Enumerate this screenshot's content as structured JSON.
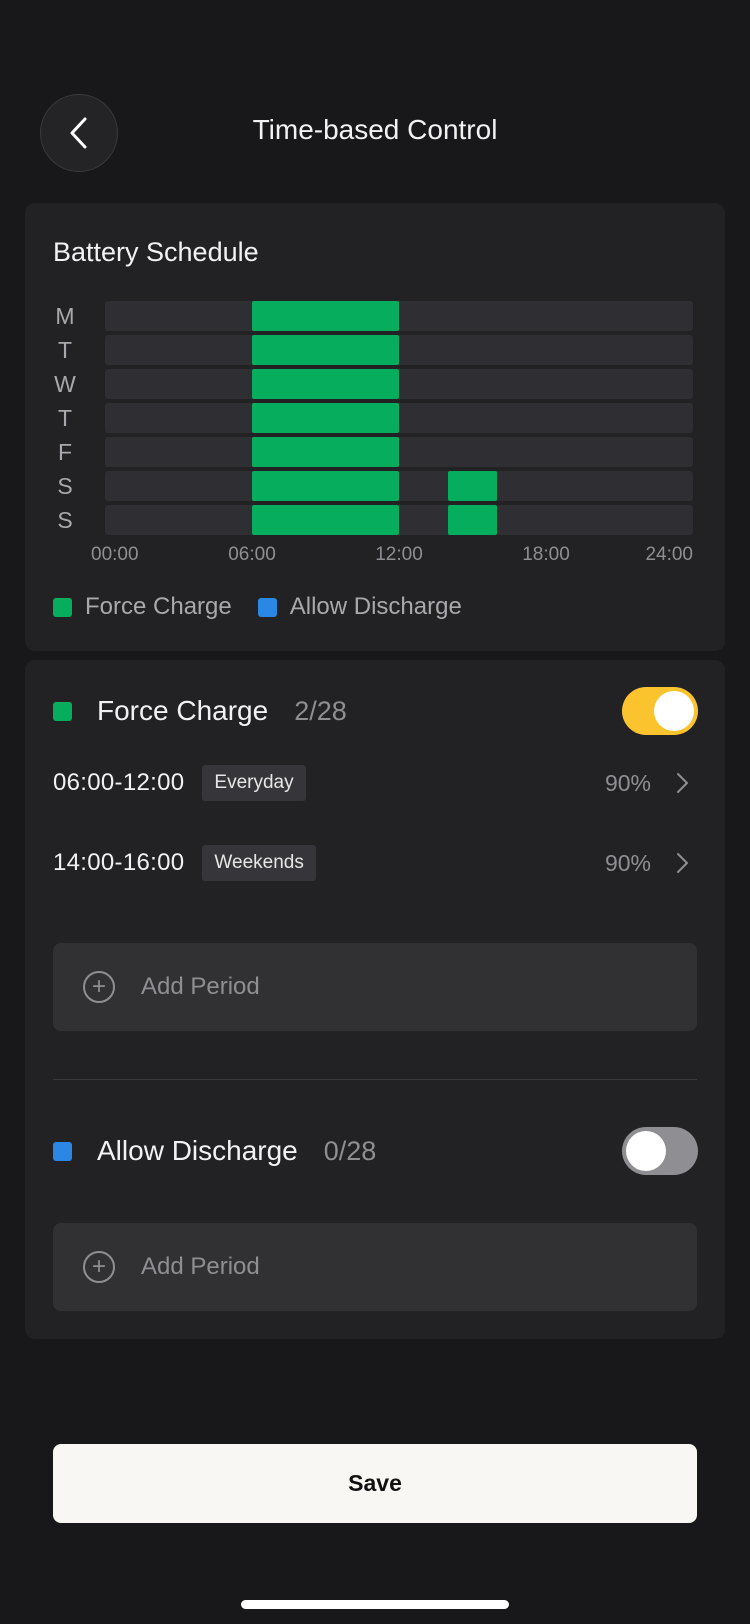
{
  "header": {
    "title": "Time-based Control"
  },
  "schedule": {
    "title": "Battery Schedule",
    "legend": [
      {
        "label": "Force Charge",
        "color": "#05ad5c"
      },
      {
        "label": "Allow Discharge",
        "color": "#2a88e4"
      }
    ]
  },
  "chart_data": {
    "type": "timeline",
    "days": [
      "M",
      "T",
      "W",
      "T",
      "F",
      "S",
      "S"
    ],
    "x_ticks": [
      "00:00",
      "06:00",
      "12:00",
      "18:00",
      "24:00"
    ],
    "x_range_hours": [
      0,
      24
    ],
    "series": [
      {
        "name": "Force Charge",
        "color": "#05ad5c",
        "blocks": [
          {
            "day": 0,
            "start": 6,
            "end": 12
          },
          {
            "day": 1,
            "start": 6,
            "end": 12
          },
          {
            "day": 2,
            "start": 6,
            "end": 12
          },
          {
            "day": 3,
            "start": 6,
            "end": 12
          },
          {
            "day": 4,
            "start": 6,
            "end": 12
          },
          {
            "day": 5,
            "start": 6,
            "end": 12
          },
          {
            "day": 6,
            "start": 6,
            "end": 12
          },
          {
            "day": 5,
            "start": 14,
            "end": 16
          },
          {
            "day": 6,
            "start": 14,
            "end": 16
          }
        ]
      },
      {
        "name": "Allow Discharge",
        "color": "#2a88e4",
        "blocks": []
      }
    ]
  },
  "force_charge": {
    "label": "Force Charge",
    "count": "2/28",
    "color": "#05ad5c",
    "enabled": true,
    "periods": [
      {
        "time": "06:00-12:00",
        "tag": "Everyday",
        "percent": "90%"
      },
      {
        "time": "14:00-16:00",
        "tag": "Weekends",
        "percent": "90%"
      }
    ],
    "add_label": "Add Period"
  },
  "allow_discharge": {
    "label": "Allow Discharge",
    "count": "0/28",
    "color": "#2a88e4",
    "enabled": false,
    "add_label": "Add Period"
  },
  "footer": {
    "save_label": "Save"
  },
  "colors": {
    "background": "#18181a",
    "card": "#222225",
    "track": "#2f2f33",
    "toggle_on": "#fbc42f"
  }
}
